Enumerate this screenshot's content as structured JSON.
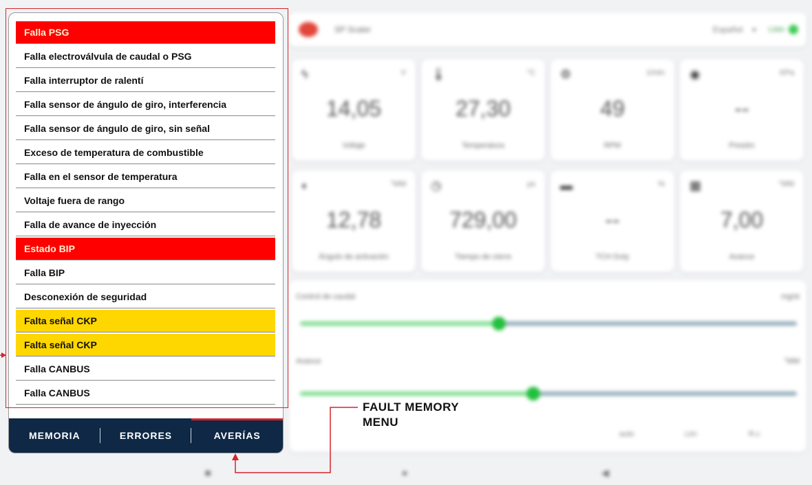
{
  "header": {
    "app_title": "SP Scaler",
    "language": "Español",
    "connection": "Listo"
  },
  "gauges": [
    {
      "icon": "bolt-icon",
      "unit": "V",
      "value": "14,05",
      "label": "Voltaje"
    },
    {
      "icon": "thermometer-icon",
      "unit": "°C",
      "value": "27,30",
      "label": "Temperatura"
    },
    {
      "icon": "engine-icon",
      "unit": "1/min",
      "value": "49",
      "label": "RPM"
    },
    {
      "icon": "pressure-icon",
      "unit": "KPa",
      "value": "--",
      "label": "Presión"
    },
    {
      "icon": "angle-icon",
      "unit": "°MM",
      "value": "12,78",
      "label": "Ángulo de activación"
    },
    {
      "icon": "clock-icon",
      "unit": "µs",
      "value": "729,00",
      "label": "Tiempo de cierre"
    },
    {
      "icon": "battery-icon",
      "unit": "%",
      "value": "--",
      "label": "TCH Duty"
    },
    {
      "icon": "advance-icon",
      "unit": "°MM",
      "value": "7,00",
      "label": "Avance"
    }
  ],
  "sliders": [
    {
      "title": "Control de caudal",
      "unit": "mg/st",
      "level": 0.4
    },
    {
      "title": "Avance",
      "unit": "°MM",
      "level": 0.47
    }
  ],
  "slider_controls": [
    "auto",
    "Lim",
    "R.c"
  ],
  "faults": [
    {
      "label": "Falla PSG",
      "style": "red"
    },
    {
      "label": "Falla electroválvula de caudal o PSG",
      "style": "normal"
    },
    {
      "label": "Falla interruptor de ralentí",
      "style": "normal"
    },
    {
      "label": "Falla sensor de ángulo de giro, interferencia",
      "style": "normal"
    },
    {
      "label": "Falla sensor de ángulo de giro, sin señal",
      "style": "normal"
    },
    {
      "label": "Exceso de temperatura de combustible",
      "style": "normal"
    },
    {
      "label": "Falla en el sensor de temperatura",
      "style": "normal"
    },
    {
      "label": "Voltaje fuera de rango",
      "style": "normal"
    },
    {
      "label": "Falla de avance de inyección",
      "style": "normal"
    },
    {
      "label": "Estado BIP",
      "style": "red"
    },
    {
      "label": "Falla BIP",
      "style": "normal"
    },
    {
      "label": "Desconexión de seguridad",
      "style": "normal"
    },
    {
      "label": "Falta señal CKP",
      "style": "yellow"
    },
    {
      "label": "Falta señal CKP",
      "style": "yellow"
    },
    {
      "label": "Falla CANBUS",
      "style": "normal"
    },
    {
      "label": "Falla CANBUS",
      "style": "normal"
    }
  ],
  "tabs": [
    {
      "label": "MEMORIA",
      "active": false
    },
    {
      "label": "ERRORES",
      "active": false
    },
    {
      "label": "AVERÍAS",
      "active": true
    }
  ],
  "callout": {
    "line1": "FAULT MEMORY",
    "line2": "MENU"
  },
  "colors": {
    "red": "#ff0000",
    "yellow": "#ffd700",
    "tabbar": "#0e2846",
    "annotation": "#d3242a"
  }
}
